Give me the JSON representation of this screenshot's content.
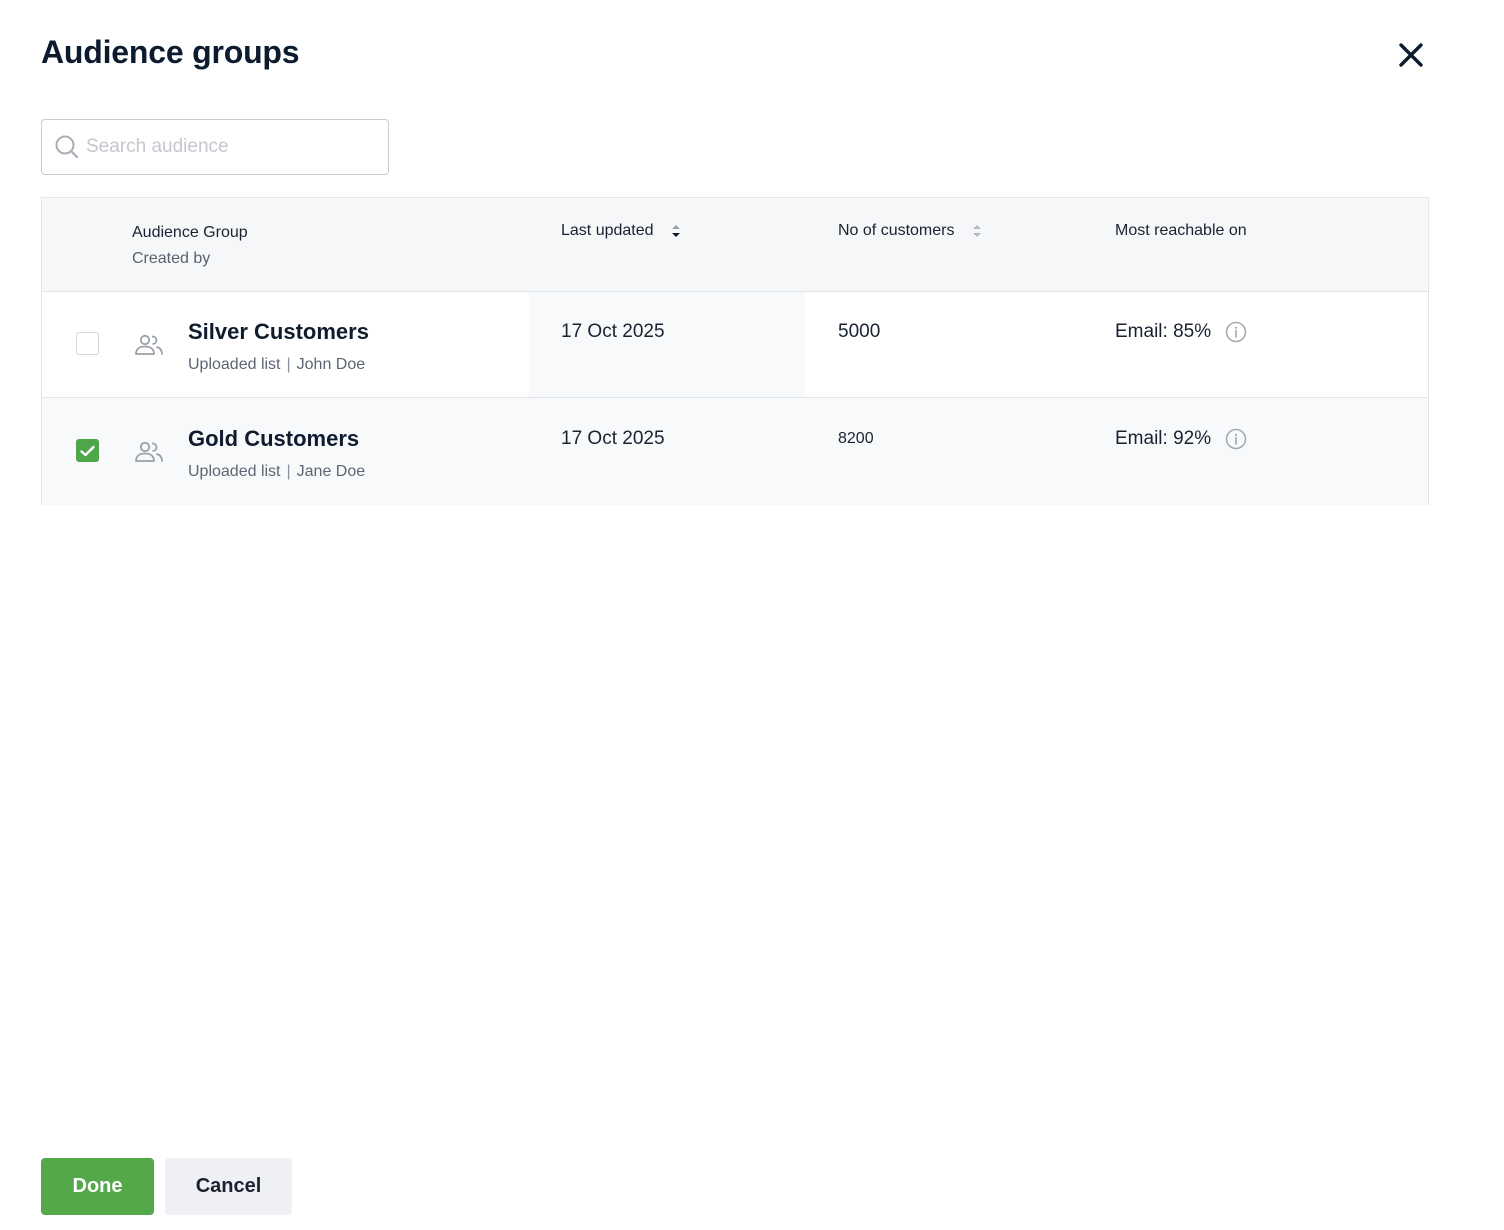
{
  "dialog": {
    "title": "Audience groups",
    "close_icon": "close-icon"
  },
  "search": {
    "placeholder": "Search audience",
    "value": "",
    "icon": "search-icon"
  },
  "table": {
    "columns": {
      "group": "Audience Group",
      "group_sub": "Created by",
      "last_updated": "Last updated",
      "customers": "No of customers",
      "reachable": "Most reachable on"
    },
    "rows": [
      {
        "name": "Silver Customers",
        "source": "Uploaded list",
        "separator": "|",
        "creator": "John Doe",
        "last_updated": "17 Oct 2025",
        "customers": "5000",
        "reachable": "Email: 85%",
        "checked": false
      },
      {
        "name": "Gold Customers",
        "source": "Uploaded list",
        "separator": "|",
        "creator": "Jane Doe",
        "last_updated": "17 Oct 2025",
        "customers": "8200",
        "reachable": "Email: 92%",
        "checked": true
      }
    ]
  },
  "footer": {
    "done_label": "Done",
    "cancel_label": "Cancel"
  },
  "colors": {
    "accent_green": "#54a84a",
    "title_text": "#0d1b2e",
    "border": "#e2e5e9"
  }
}
